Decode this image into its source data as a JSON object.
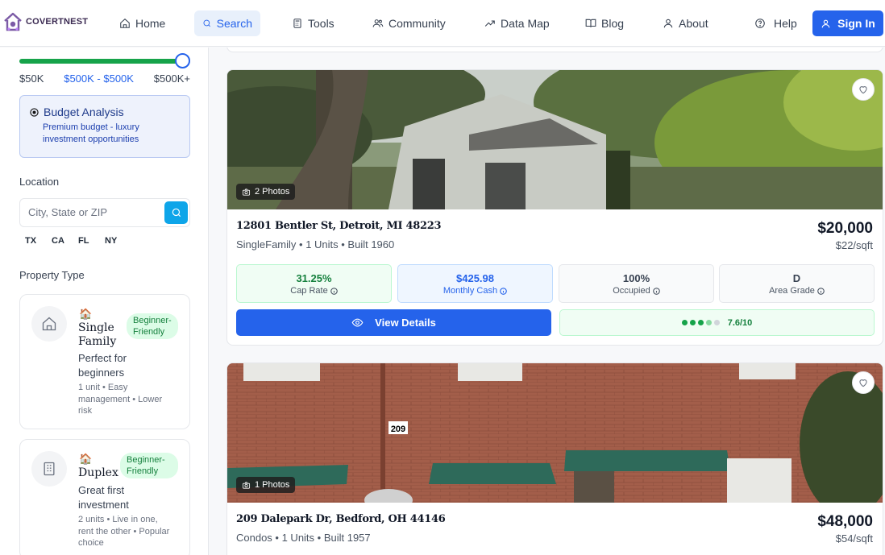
{
  "header": {
    "brand": "COVERTNEST",
    "nav": [
      {
        "label": "Home",
        "icon": "home-icon"
      },
      {
        "label": "Search",
        "icon": "search-icon"
      },
      {
        "label": "Tools",
        "icon": "calculator-icon"
      },
      {
        "label": "Community",
        "icon": "users-icon"
      },
      {
        "label": "Data Map",
        "icon": "trending-icon"
      },
      {
        "label": "Blog",
        "icon": "book-icon"
      },
      {
        "label": "About",
        "icon": "user-icon"
      }
    ],
    "help_label": "Help",
    "signin_label": "Sign In",
    "accent": "#2563eb"
  },
  "sidebar": {
    "budget_range": {
      "min_label": "$50K",
      "selected_label": "$500K - $500K",
      "max_label": "$500K+",
      "slider_position": 1.0
    },
    "budget_analysis": {
      "title": "Budget Analysis",
      "description": "Premium budget - luxury investment opportunities"
    },
    "location": {
      "label": "Location",
      "placeholder": "City, State or ZIP",
      "states": [
        "TX",
        "CA",
        "FL",
        "NY"
      ]
    },
    "property_type": {
      "label": "Property Type",
      "items": [
        {
          "emoji": "🏠",
          "name": "Single Family",
          "tag": "Beginner-Friendly",
          "description": "Perfect for beginners",
          "details": "1 unit • Easy management • Lower risk"
        },
        {
          "emoji": "🏠",
          "name": "Duplex",
          "tag": "Beginner-Friendly",
          "description": "Great first investment",
          "details": "2 units • Live in one, rent the other • Popular choice"
        }
      ]
    }
  },
  "listings": [
    {
      "photos": "2 Photos",
      "address": "12801 Bentler St, Detroit, MI 48223",
      "meta": "SingleFamily • 1 Units • Built 1960",
      "price": "$20,000",
      "price_sqft": "$22/sqft",
      "metrics": [
        {
          "value": "31.25%",
          "label": "Cap Rate"
        },
        {
          "value": "$425.98",
          "label": "Monthly Cash"
        },
        {
          "value": "100%",
          "label": "Occupied"
        },
        {
          "value": "D",
          "label": "Area Grade"
        }
      ],
      "view_label": "View Details",
      "score": "7.6/10",
      "score_value": 7.6
    },
    {
      "photos": "1 Photos",
      "address": "209 Dalepark Dr, Bedford, OH 44146",
      "meta": "Condos • 1 Units • Built 1957",
      "price": "$48,000",
      "price_sqft": "$54/sqft"
    }
  ]
}
